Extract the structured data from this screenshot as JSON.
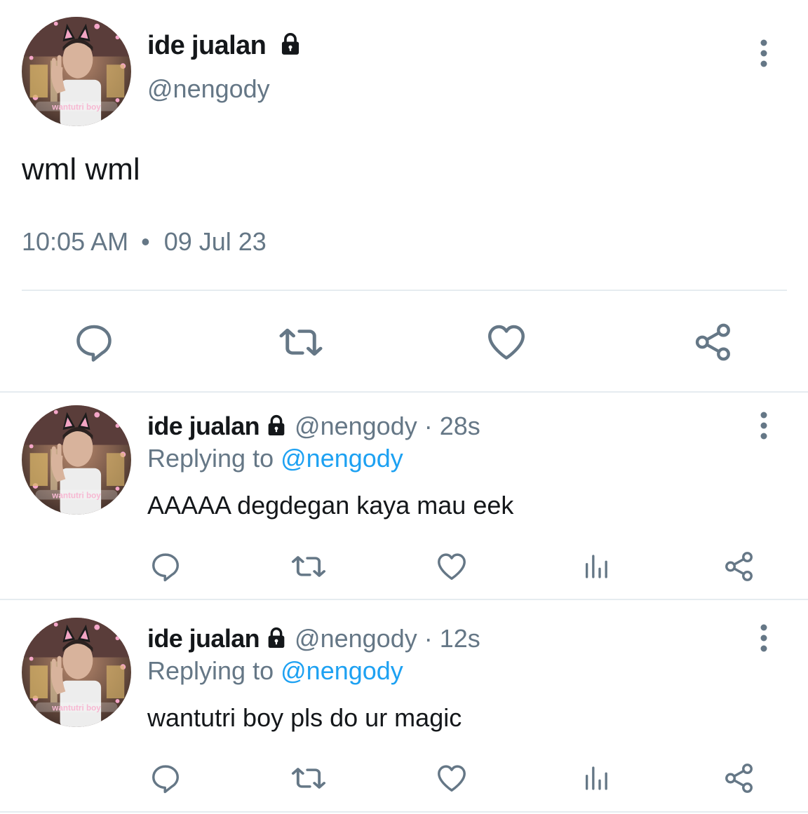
{
  "main_tweet": {
    "display_name": "ide jualan",
    "handle": "@nengody",
    "text": "wml wml",
    "time": "10:05 AM",
    "separator": "•",
    "date": "09 Jul 23",
    "avatar_caption": "wantutri boy"
  },
  "replies": [
    {
      "display_name": "ide jualan",
      "handle": "@nengody",
      "separator": "·",
      "time": "28s",
      "replying_label": "Replying to",
      "replying_to": "@nengody",
      "text": "AAAAA degdegan kaya mau eek",
      "avatar_caption": "wantutri boy"
    },
    {
      "display_name": "ide jualan",
      "handle": "@nengody",
      "separator": "·",
      "time": "12s",
      "replying_label": "Replying to",
      "replying_to": "@nengody",
      "text": "wantutri boy pls do ur magic",
      "avatar_caption": "wantutri boy"
    }
  ],
  "icons": {
    "protected": "lock-icon",
    "more": "more-vertical-icon",
    "reply": "reply-icon",
    "retweet": "retweet-icon",
    "like": "heart-icon",
    "analytics": "analytics-icon",
    "share": "share-icon"
  },
  "colors": {
    "text_primary": "#14171a",
    "text_secondary": "#657786",
    "link": "#1da1f2",
    "icon": "#657786",
    "divider": "#e6ecf0"
  }
}
